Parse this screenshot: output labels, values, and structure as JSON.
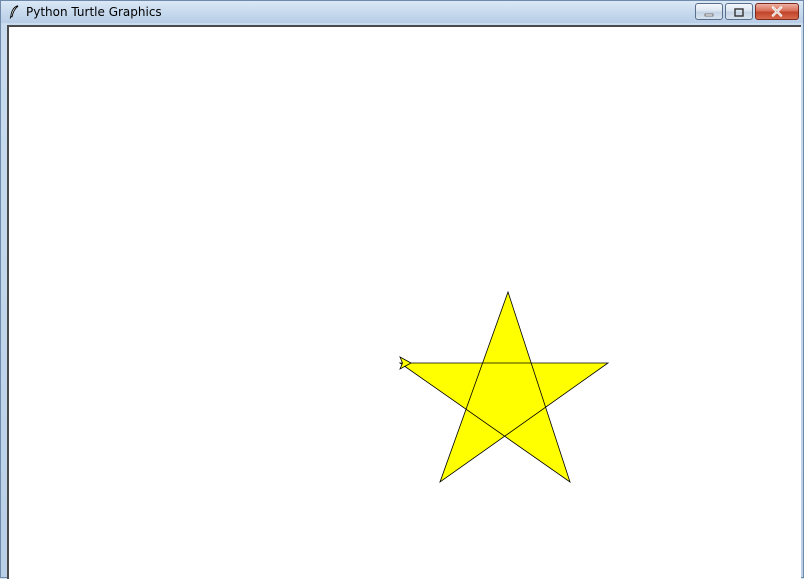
{
  "window": {
    "title": "Python Turtle Graphics",
    "icon": "feather-icon"
  },
  "controls": {
    "minimize_icon": "minimize-icon",
    "maximize_icon": "maximize-icon",
    "close_icon": "close-icon"
  },
  "canvas": {
    "background": "#ffffff",
    "shape": "five-pointed-star",
    "fill_color": "#ffff00",
    "stroke_color": "#000000",
    "turtle_cursor": "arrow-turtle-icon",
    "turtle_color": "#ffff00"
  }
}
